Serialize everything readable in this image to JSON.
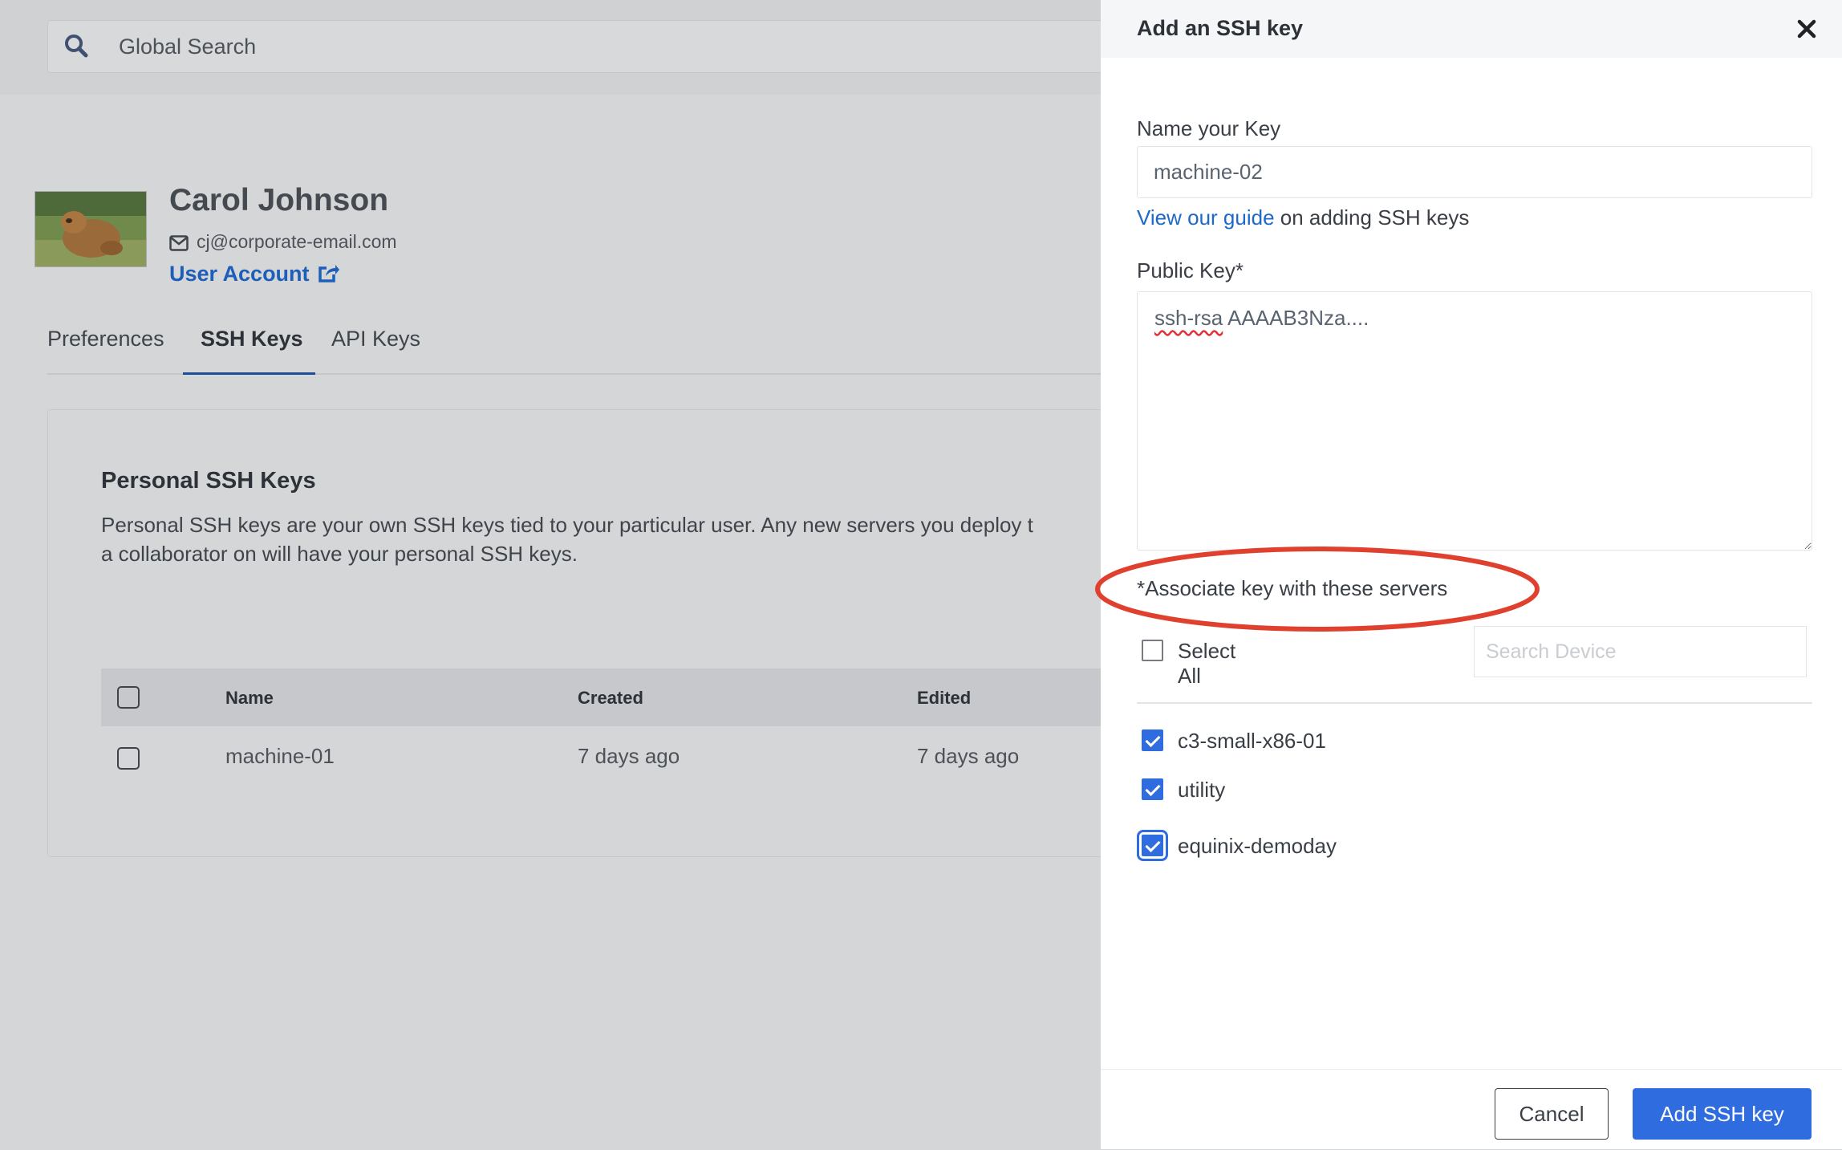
{
  "search": {
    "placeholder": "Global Search"
  },
  "profile": {
    "name": "Carol Johnson",
    "email": "cj@corporate-email.com",
    "account_link": "User Account"
  },
  "tabs": [
    {
      "label": "Preferences"
    },
    {
      "label": "SSH Keys",
      "active": true
    },
    {
      "label": "API Keys"
    }
  ],
  "card": {
    "title": "Personal SSH Keys",
    "description": "Personal SSH keys are your own SSH keys tied to your particular user. Any new servers you deploy t",
    "description_line2": "a collaborator on will have your personal SSH keys.",
    "columns": [
      "Name",
      "Created",
      "Edited"
    ],
    "rows": [
      {
        "name": "machine-01",
        "created": "7 days ago",
        "edited": "7 days ago"
      }
    ]
  },
  "panel": {
    "title": "Add an SSH key",
    "name_label": "Name your Key",
    "name_value": "machine-02",
    "guide_link": "View our guide",
    "guide_rest": " on adding SSH keys",
    "public_key_label": "Public Key*",
    "public_key_prefix": "ssh-rsa",
    "public_key_rest": " AAAAB3Nza....",
    "associate_label": "*Associate key with these servers",
    "select_all": "Select All",
    "device_search_placeholder": "Search Device",
    "servers": [
      {
        "name": "c3-small-x86-01",
        "checked": true
      },
      {
        "name": "utility",
        "checked": true
      },
      {
        "name": "equinix-demoday",
        "checked": true
      }
    ],
    "cancel": "Cancel",
    "submit": "Add SSH key"
  },
  "colors": {
    "accent": "#2f6ce0",
    "link": "#1d68c9",
    "highlight_oval": "#e0412f"
  }
}
